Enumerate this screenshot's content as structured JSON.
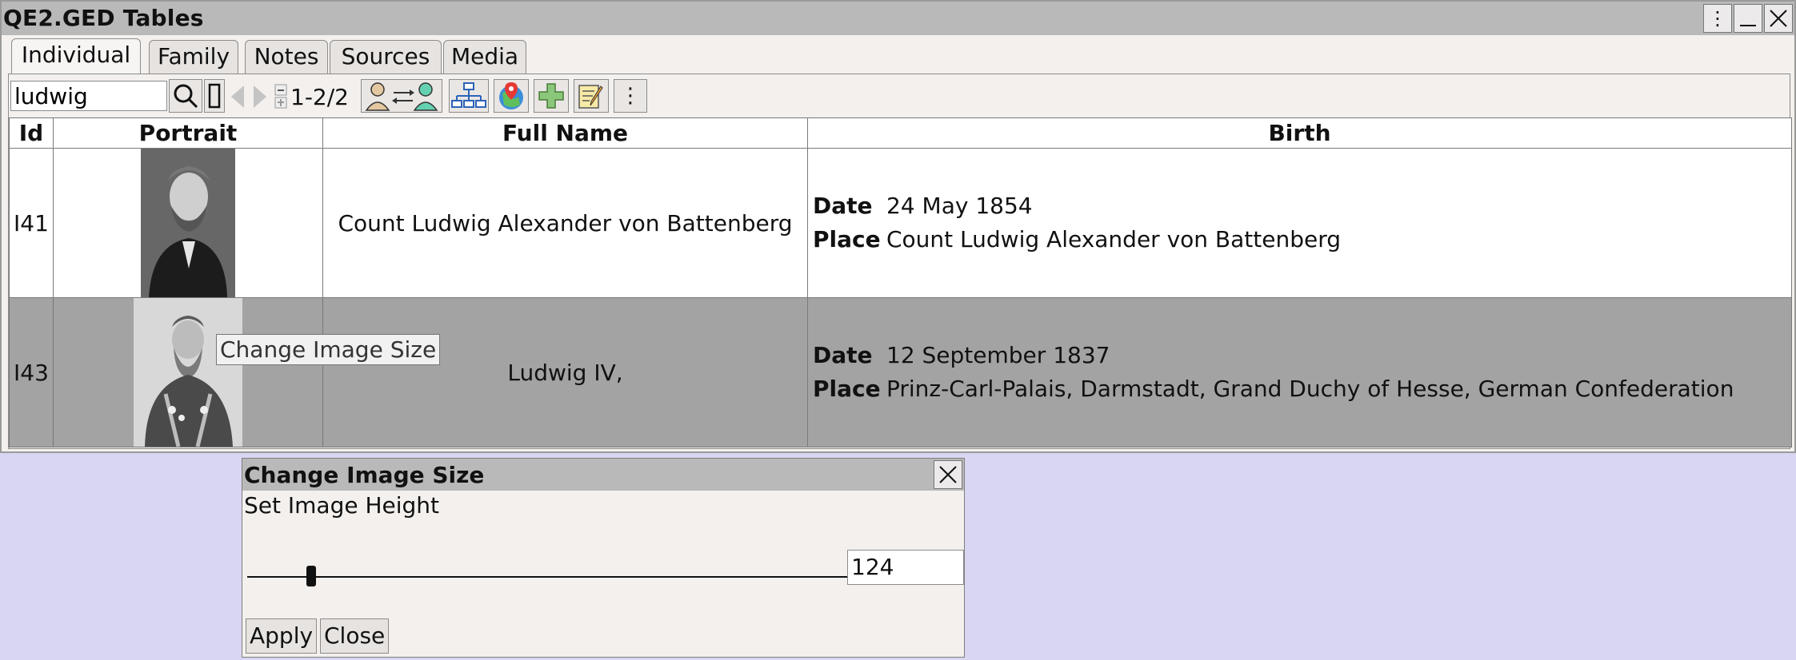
{
  "window": {
    "title": "QE2.GED Tables",
    "controls": [
      "menu",
      "minimize",
      "close"
    ]
  },
  "tabs": [
    {
      "label": "Individual",
      "active": true
    },
    {
      "label": "Family"
    },
    {
      "label": "Notes"
    },
    {
      "label": "Sources"
    },
    {
      "label": "Media"
    }
  ],
  "toolbar": {
    "search_value": "ludwig",
    "counter": "1-2/2",
    "icons": [
      "search-icon",
      "toggle-icon",
      "prev-icon",
      "next-icon",
      "expand-collapse-icon",
      "swap-persons-icon",
      "tree-icon",
      "map-icon",
      "add-icon",
      "edit-icon",
      "more-icon"
    ]
  },
  "table": {
    "headers": {
      "id": "Id",
      "portrait": "Portrait",
      "full_name": "Full Name",
      "birth": "Birth"
    },
    "rows": [
      {
        "id": "I41",
        "full_name": "Count Ludwig Alexander von Battenberg",
        "date_label": "Date",
        "date": "24 May 1854",
        "place_label": "Place",
        "place": "Count Ludwig Alexander von Battenberg",
        "selected": false
      },
      {
        "id": "I43",
        "full_name": "Ludwig IV,",
        "date_label": "Date",
        "date": "12 September 1837",
        "place_label": "Place",
        "place": "Prinz-Carl-Palais, Darmstadt, Grand Duchy of Hesse, German Confederation",
        "selected": true
      }
    ]
  },
  "tooltip": "Change Image Size",
  "dialog": {
    "title": "Change Image Size",
    "label": "Set Image Height",
    "value": "124",
    "apply": "Apply",
    "close": "Close"
  },
  "colors": {
    "titlebar": "#b9b9b9",
    "selected_row": "#a3a3a3",
    "desktop": "#d9d6f2"
  }
}
